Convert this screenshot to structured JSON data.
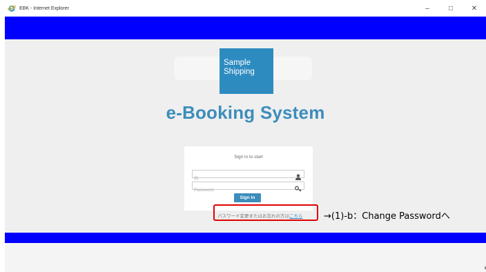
{
  "window": {
    "title": "EBK - Internet Explorer",
    "icon": "ie-icon",
    "controls": {
      "minimize": "–",
      "maximize": "□",
      "close": "✕"
    }
  },
  "logo": {
    "line1": "Sample",
    "line2": "Shipping"
  },
  "app": {
    "title": "e-Booking System"
  },
  "login": {
    "message": "Sign in to start",
    "id_placeholder": "ID",
    "password_placeholder": "Password",
    "signin_label": "Sign in",
    "forgot_text": "パスワード変更またはお忘れの方は",
    "forgot_link": "こちら"
  },
  "annotation": {
    "text": "→(1)-b：Change Passwordへ"
  },
  "colors": {
    "band": "#0000ff",
    "accent": "#3c8dbc",
    "logo_bg": "#2e8bc0",
    "highlight": "#e00000"
  }
}
